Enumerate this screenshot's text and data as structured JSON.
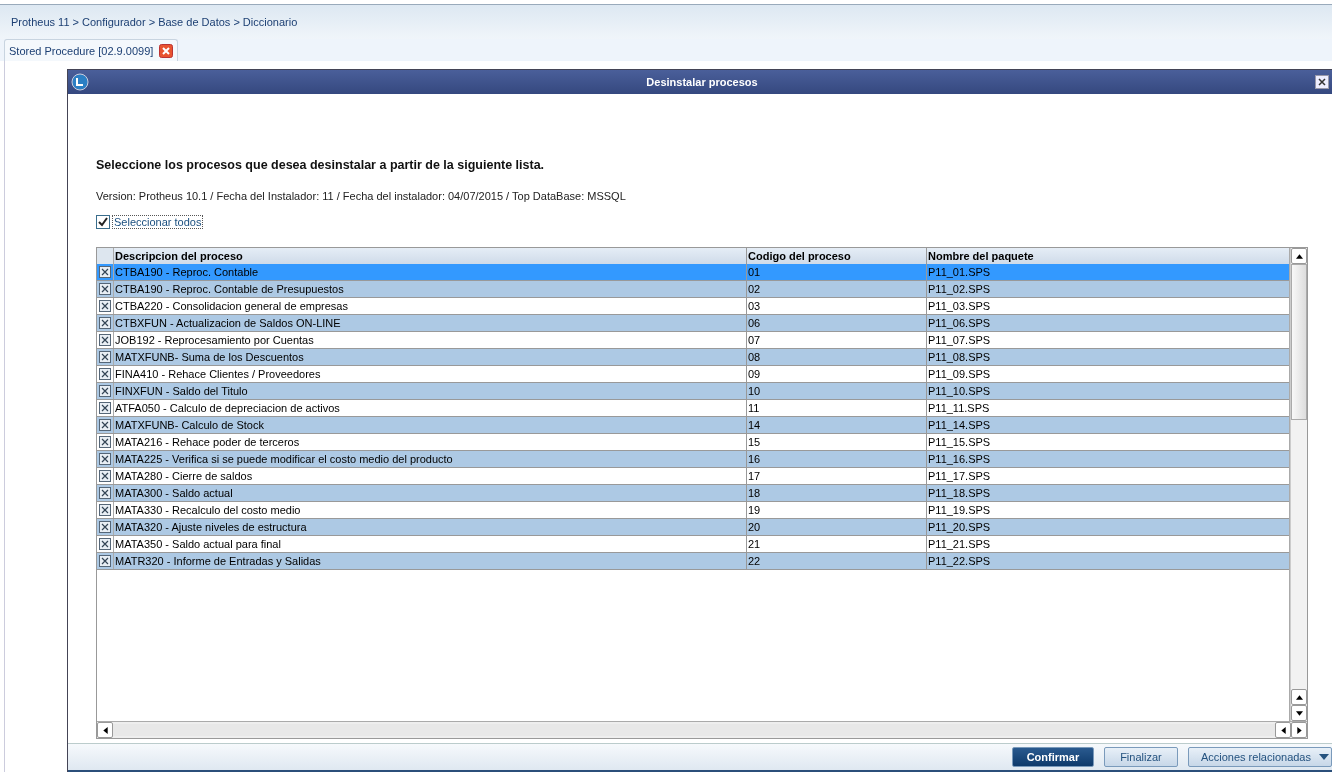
{
  "breadcrumb": "Protheus 11 > Configurador > Base de Datos > Diccionario",
  "tab": {
    "label": "Stored Procedure [02.9.0099]"
  },
  "dialog": {
    "title": "Desinstalar procesos",
    "heading": "Seleccione los procesos que desea desinstalar a partir de la siguiente lista.",
    "info": "Version: Protheus 10.1 / Fecha del Instalador: 11 / Fecha del instalador: 04/07/2015 / Top DataBase: MSSQL",
    "select_all": {
      "label": "Seleccionar todos",
      "checked": true
    },
    "table": {
      "columns": [
        "Descripcion del proceso",
        "Codigo del proceso",
        "Nombre del paquete"
      ],
      "rows": [
        {
          "cells": [
            "CTBA190 - Reproc. Contable",
            "01",
            "P11_01.SPS"
          ],
          "checked": true,
          "selected": true
        },
        {
          "cells": [
            "CTBA190 - Reproc. Contable de Presupuestos",
            "02",
            "P11_02.SPS"
          ],
          "checked": true,
          "selected": false
        },
        {
          "cells": [
            "CTBA220 - Consolidacion general de empresas",
            "03",
            "P11_03.SPS"
          ],
          "checked": true,
          "selected": false
        },
        {
          "cells": [
            "CTBXFUN - Actualizacion de Saldos ON-LINE",
            "06",
            "P11_06.SPS"
          ],
          "checked": true,
          "selected": false
        },
        {
          "cells": [
            "JOB192 - Reprocesamiento por Cuentas",
            "07",
            "P11_07.SPS"
          ],
          "checked": true,
          "selected": false
        },
        {
          "cells": [
            "MATXFUNB- Suma de los Descuentos",
            "08",
            "P11_08.SPS"
          ],
          "checked": true,
          "selected": false
        },
        {
          "cells": [
            "FINA410 - Rehace Clientes / Proveedores",
            "09",
            "P11_09.SPS"
          ],
          "checked": true,
          "selected": false
        },
        {
          "cells": [
            "FINXFUN - Saldo del Titulo",
            "10",
            "P11_10.SPS"
          ],
          "checked": true,
          "selected": false
        },
        {
          "cells": [
            "ATFA050 - Calculo de depreciacion de activos",
            "11",
            "P11_11.SPS"
          ],
          "checked": true,
          "selected": false
        },
        {
          "cells": [
            "MATXFUNB- Calculo de Stock",
            "14",
            "P11_14.SPS"
          ],
          "checked": true,
          "selected": false
        },
        {
          "cells": [
            "MATA216 - Rehace poder de terceros",
            "15",
            "P11_15.SPS"
          ],
          "checked": true,
          "selected": false
        },
        {
          "cells": [
            "MATA225 - Verifica si se puede modificar el costo medio del producto",
            "16",
            "P11_16.SPS"
          ],
          "checked": true,
          "selected": false
        },
        {
          "cells": [
            "MATA280 - Cierre de saldos",
            "17",
            "P11_17.SPS"
          ],
          "checked": true,
          "selected": false
        },
        {
          "cells": [
            "MATA300 - Saldo actual",
            "18",
            "P11_18.SPS"
          ],
          "checked": true,
          "selected": false
        },
        {
          "cells": [
            "MATA330 - Recalculo del costo medio",
            "19",
            "P11_19.SPS"
          ],
          "checked": true,
          "selected": false
        },
        {
          "cells": [
            "MATA320 - Ajuste niveles de estructura",
            "20",
            "P11_20.SPS"
          ],
          "checked": true,
          "selected": false
        },
        {
          "cells": [
            "MATA350 - Saldo actual para final",
            "21",
            "P11_21.SPS"
          ],
          "checked": true,
          "selected": false
        },
        {
          "cells": [
            "MATR320 - Informe de Entradas y Salidas",
            "22",
            "P11_22.SPS"
          ],
          "checked": true,
          "selected": false
        }
      ]
    },
    "buttons": [
      {
        "label": "Confirmar",
        "kind": "primary"
      },
      {
        "label": "Finalizar",
        "kind": "secondary"
      },
      {
        "label": "Acciones relacionadas",
        "kind": "dropdown"
      }
    ]
  }
}
